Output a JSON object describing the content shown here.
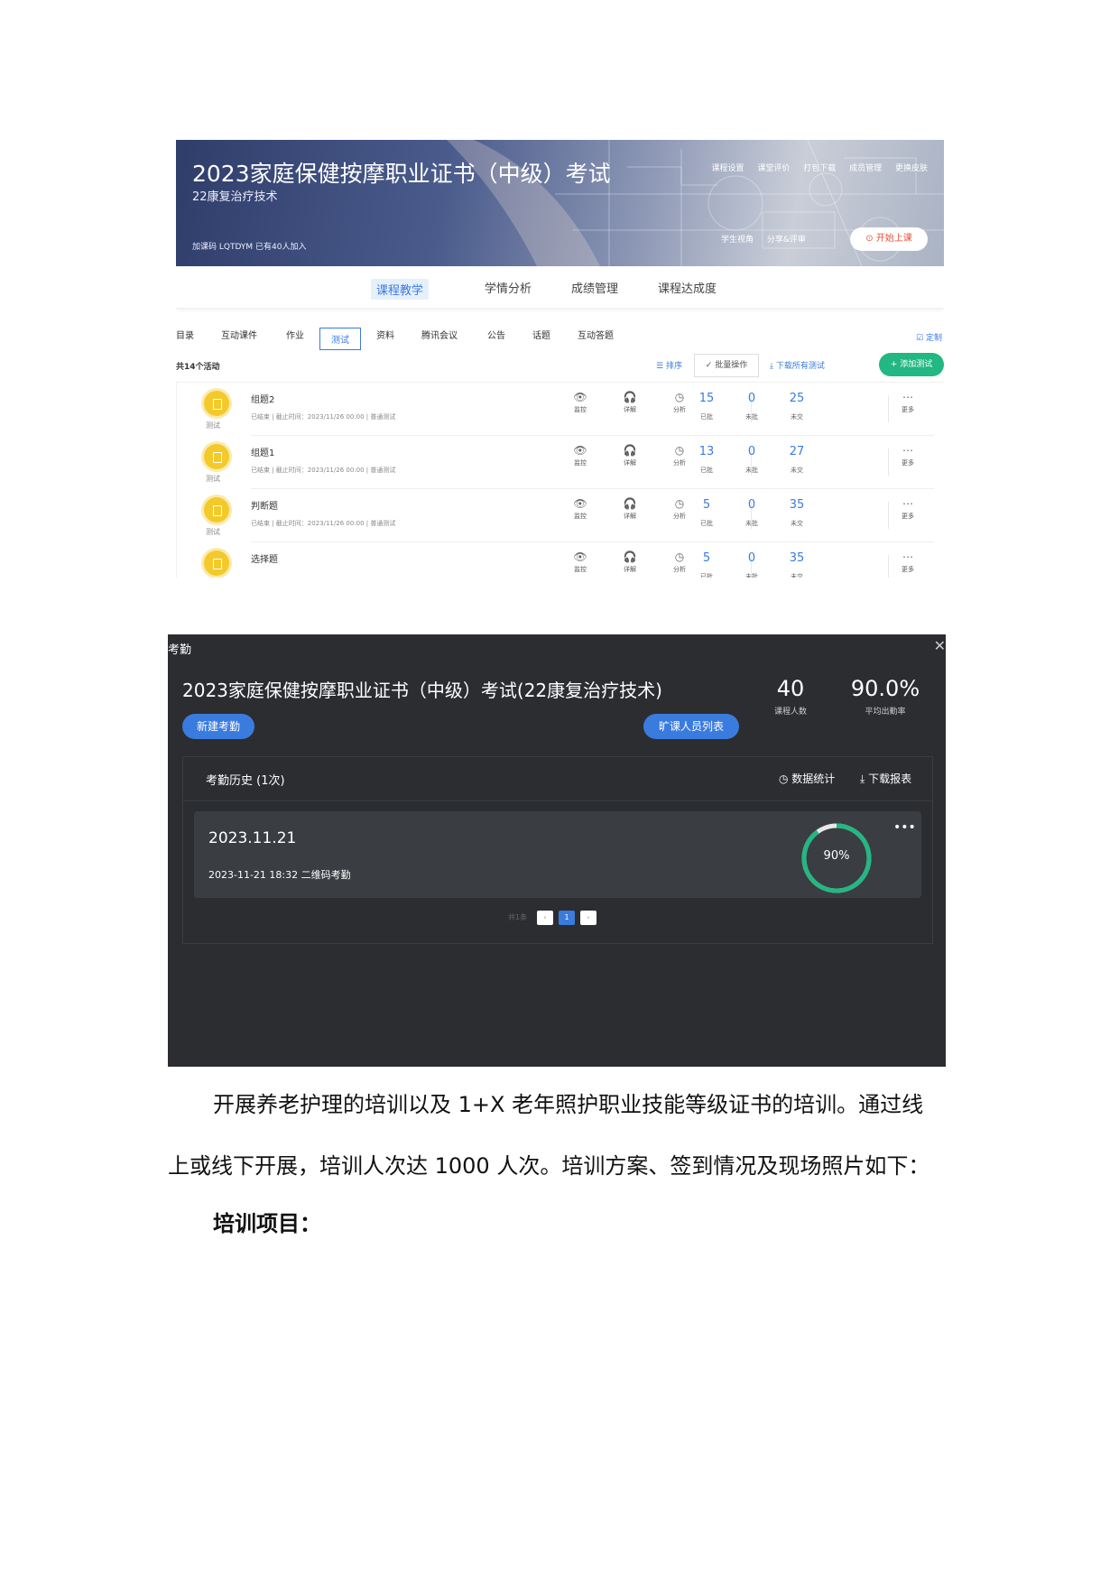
{
  "course": {
    "title": "2023家庭保健按摩职业证书（中级）考试",
    "subtitle": "22康复治疗技术",
    "meta": "加课码 LQTDYM   已有40人加入",
    "top_links": [
      "课程设置",
      "课堂评价",
      "打包下载",
      "成员管理",
      "更换皮肤"
    ],
    "view_links": [
      "学生视角",
      "分享&评审"
    ],
    "start_button": "开始上课"
  },
  "main_tabs": [
    "课程教学",
    "学情分析",
    "成绩管理",
    "课程达成度"
  ],
  "sub_tabs": [
    "目录",
    "互动课件",
    "作业",
    "测试",
    "资料",
    "腾讯会议",
    "公告",
    "话题",
    "互动答题"
  ],
  "customize": "定制",
  "activity_count": "共14个活动",
  "toolbar": {
    "sort": "排序",
    "batch": "批量操作",
    "download": "下载所有测试",
    "add": "+ 添加测试"
  },
  "actions": {
    "monitor": "监控",
    "detail": "详解",
    "analysis": "分析",
    "more": "更多"
  },
  "num_labels": {
    "graded": "已批",
    "ungraded": "未批",
    "unsubmitted": "未交"
  },
  "activities": [
    {
      "tag": "测试",
      "name": "组题2",
      "meta": "已结束 | 截止时间：2023/11/26 00:00 | 普通测试",
      "graded": "15",
      "ungraded": "0",
      "unsubmitted": "25"
    },
    {
      "tag": "测试",
      "name": "组题1",
      "meta": "已结束 | 截止时间：2023/11/26 00:00 | 普通测试",
      "graded": "13",
      "ungraded": "0",
      "unsubmitted": "27"
    },
    {
      "tag": "测试",
      "name": "判断题",
      "meta": "已结束 | 截止时间：2023/11/26 00:00 | 普通测试",
      "graded": "5",
      "ungraded": "0",
      "unsubmitted": "35"
    },
    {
      "tag": "测试",
      "name": "选择题",
      "meta": "",
      "graded": "5",
      "ungraded": "0",
      "unsubmitted": "35"
    }
  ],
  "attendance": {
    "label": "考勤",
    "title": "2023家庭保健按摩职业证书（中级）考试(22康复治疗技术)",
    "new_button": "新建考勤",
    "absent_button": "旷课人员列表",
    "student_count": "40",
    "student_count_label": "课程人数",
    "avg_rate": "90.0%",
    "avg_rate_label": "平均出勤率",
    "history_title": "考勤历史 (1次)",
    "stats_link": "数据统计",
    "download_link": "下载报表",
    "record": {
      "date": "2023.11.21",
      "desc": "2023-11-21 18:32 二维码考勤",
      "rate_label": "90%",
      "rate": 0.9
    },
    "pager_total": "共1条",
    "pager_page": "1"
  },
  "body": {
    "p1": "开展养老护理的培训以及 1+X 老年照护职业技能等级证书的培训。通过线",
    "p2": "上或线下开展，培训人次达 1000 人次。培训方案、签到情况及现场照片如下：",
    "p3": "培训项目："
  },
  "colors": {
    "accent": "#3a7bde",
    "green": "#22b783",
    "badge": "#f3c92b"
  }
}
